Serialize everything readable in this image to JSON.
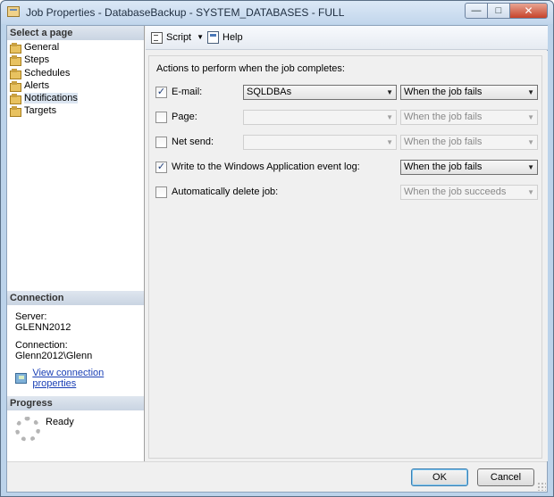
{
  "window": {
    "title": "Job Properties - DatabaseBackup - SYSTEM_DATABASES - FULL",
    "minimize_icon": "minimize-icon",
    "maximize_icon": "maximize-icon",
    "close_icon": "close-icon"
  },
  "sidebar": {
    "header": "Select a page",
    "items": [
      {
        "label": "General",
        "icon": "page-icon"
      },
      {
        "label": "Steps",
        "icon": "page-icon"
      },
      {
        "label": "Schedules",
        "icon": "page-icon"
      },
      {
        "label": "Alerts",
        "icon": "page-icon"
      },
      {
        "label": "Notifications",
        "icon": "page-icon",
        "selected": true
      },
      {
        "label": "Targets",
        "icon": "page-icon"
      }
    ]
  },
  "connection": {
    "header": "Connection",
    "server_label": "Server:",
    "server_value": "GLENN2012",
    "connection_label": "Connection:",
    "connection_value": "Glenn2012\\Glenn",
    "link_label": "View connection properties"
  },
  "progress": {
    "header": "Progress",
    "status": "Ready"
  },
  "toolbar": {
    "script_label": "Script",
    "help_label": "Help"
  },
  "notifications": {
    "heading": "Actions to perform when the job completes:",
    "email": {
      "label": "E-mail:",
      "checked": true,
      "operator": "SQLDBAs",
      "condition": "When the job fails"
    },
    "page": {
      "label": "Page:",
      "checked": false,
      "operator": "",
      "condition": "When the job fails"
    },
    "net_send": {
      "label": "Net send:",
      "checked": false,
      "operator": "",
      "condition": "When the job fails"
    },
    "event_log": {
      "label": "Write to the Windows Application event log:",
      "checked": true,
      "condition": "When the job fails"
    },
    "auto_delete": {
      "label": "Automatically delete job:",
      "checked": false,
      "condition": "When the job succeeds"
    }
  },
  "buttons": {
    "ok": "OK",
    "cancel": "Cancel"
  }
}
